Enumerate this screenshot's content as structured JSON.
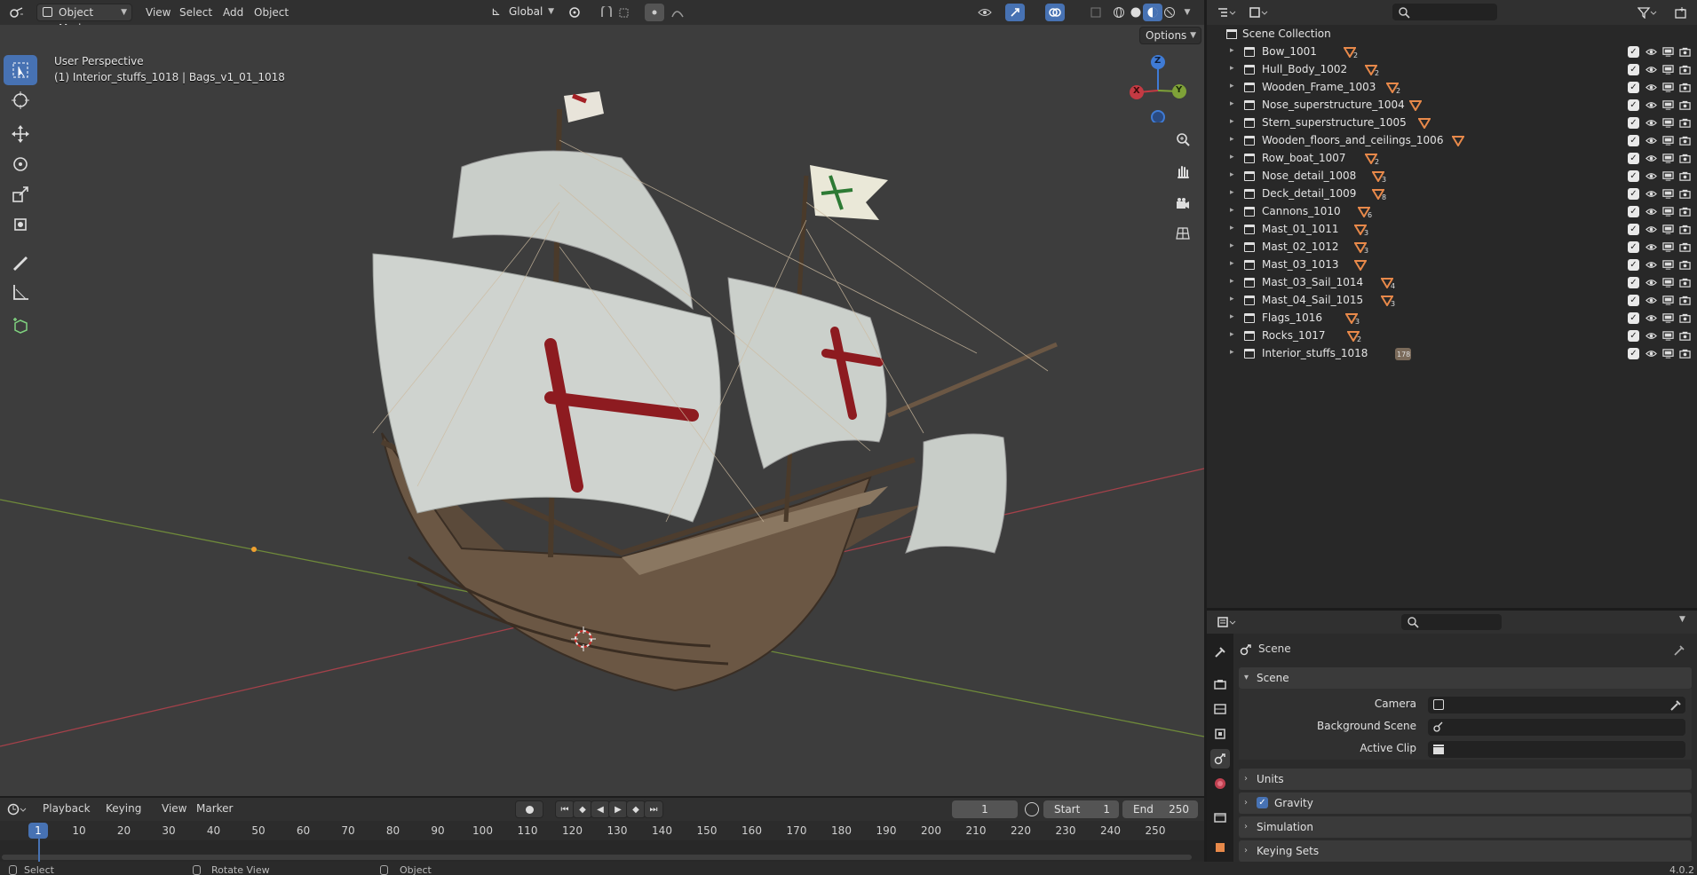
{
  "header": {
    "mode": "Object Mode",
    "menus": [
      "View",
      "Select",
      "Add",
      "Object"
    ],
    "orientation": "Global",
    "options_label": "Options"
  },
  "viewport": {
    "perspective": "User Perspective",
    "active_object": "(1) Interior_stuffs_1018 | Bags_v1_01_1018",
    "axes": {
      "x": "X",
      "y": "Y",
      "z": "Z"
    }
  },
  "outliner": {
    "root": "Scene Collection",
    "items": [
      {
        "name": "Bow_1001",
        "count": "2"
      },
      {
        "name": "Hull_Body_1002",
        "count": "2"
      },
      {
        "name": "Wooden_Frame_1003",
        "count": "2"
      },
      {
        "name": "Nose_superstructure_1004",
        "count": ""
      },
      {
        "name": "Stern_superstructure_1005",
        "count": ""
      },
      {
        "name": "Wooden_floors_and_ceilings_1006",
        "count": ""
      },
      {
        "name": "Row_boat_1007",
        "count": "2"
      },
      {
        "name": "Nose_detail_1008",
        "count": "3"
      },
      {
        "name": "Deck_detail_1009",
        "count": "8"
      },
      {
        "name": "Cannons_1010",
        "count": "6"
      },
      {
        "name": "Mast_01_1011",
        "count": "3"
      },
      {
        "name": "Mast_02_1012",
        "count": "3"
      },
      {
        "name": "Mast_03_1013",
        "count": ""
      },
      {
        "name": "Mast_03_Sail_1014",
        "count": "4"
      },
      {
        "name": "Mast_04_Sail_1015",
        "count": "3"
      },
      {
        "name": "Flags_1016",
        "count": "3"
      },
      {
        "name": "Rocks_1017",
        "count": "2"
      },
      {
        "name": "Interior_stuffs_1018",
        "count": "178"
      }
    ]
  },
  "properties": {
    "context": "Scene",
    "panel_scene": "Scene",
    "camera_label": "Camera",
    "background_label": "Background Scene",
    "clip_label": "Active Clip",
    "panels": [
      "Units",
      "Gravity",
      "Simulation",
      "Keying Sets"
    ]
  },
  "timeline": {
    "menus": [
      "Playback",
      "Keying",
      "View",
      "Marker"
    ],
    "current_frame": "1",
    "start_label": "Start",
    "start": "1",
    "end_label": "End",
    "end": "250",
    "ticks": [
      "10",
      "20",
      "30",
      "40",
      "50",
      "60",
      "70",
      "80",
      "90",
      "100",
      "110",
      "120",
      "130",
      "140",
      "150",
      "160",
      "170",
      "180",
      "190",
      "200",
      "210",
      "220",
      "230",
      "240",
      "250"
    ],
    "playhead": "1"
  },
  "statusbar": {
    "select": "Select",
    "rotate": "Rotate View",
    "object": "Object",
    "version": "4.0.2"
  },
  "colors": {
    "accent": "#4772b3",
    "viewport_bg": "#3d3d3d",
    "triangle": "#e8894a"
  }
}
